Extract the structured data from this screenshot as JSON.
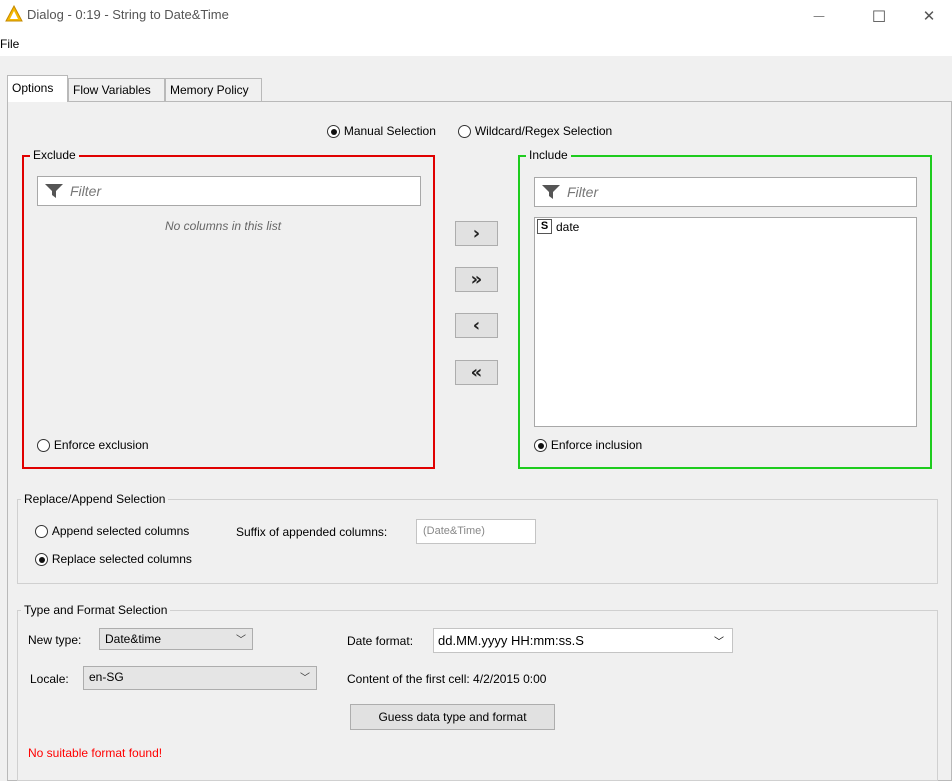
{
  "window": {
    "title": "Dialog - 0:19 - String to Date&Time",
    "minimize_glyph": "—",
    "maximize_glyph": "☐",
    "close_glyph": "✕"
  },
  "menu": {
    "file": "File"
  },
  "tabs": [
    {
      "label": "Options",
      "active": true
    },
    {
      "label": "Flow Variables",
      "active": false
    },
    {
      "label": "Memory Policy",
      "active": false
    }
  ],
  "selection_mode": {
    "manual": "Manual Selection",
    "wildcard": "Wildcard/Regex Selection",
    "selected": "manual"
  },
  "exclude": {
    "title": "Exclude",
    "filter_placeholder": "Filter",
    "empty_text": "No columns in this list",
    "enforce_label": "Enforce exclusion",
    "enforce_selected": false
  },
  "include": {
    "title": "Include",
    "filter_placeholder": "Filter",
    "columns": [
      {
        "type_badge": "S",
        "name": "date"
      }
    ],
    "enforce_label": "Enforce inclusion",
    "enforce_selected": true
  },
  "move_buttons": {
    "add": "›",
    "add_all": "»",
    "remove": "‹",
    "remove_all": "«"
  },
  "replace_append": {
    "title": "Replace/Append Selection",
    "append_label": "Append selected columns",
    "replace_label": "Replace selected columns",
    "selected": "replace",
    "suffix_label": "Suffix of appended columns:",
    "suffix_value": "(Date&Time)"
  },
  "type_format": {
    "title": "Type and Format Selection",
    "new_type_label": "New type:",
    "new_type_value": "Date&time",
    "date_format_label": "Date format:",
    "date_format_value": "dd.MM.yyyy HH:mm:ss.S",
    "locale_label": "Locale:",
    "locale_value": "en-SG",
    "first_cell_text": "Content of the first cell: 4/2/2015 0:00",
    "guess_button": "Guess data type and format",
    "error_text": "No suitable format found!"
  },
  "colors": {
    "exclude_border": "#e00000",
    "include_border": "#1ecc1e",
    "error_text": "#ff0000",
    "app_icon": "#f5b800"
  }
}
